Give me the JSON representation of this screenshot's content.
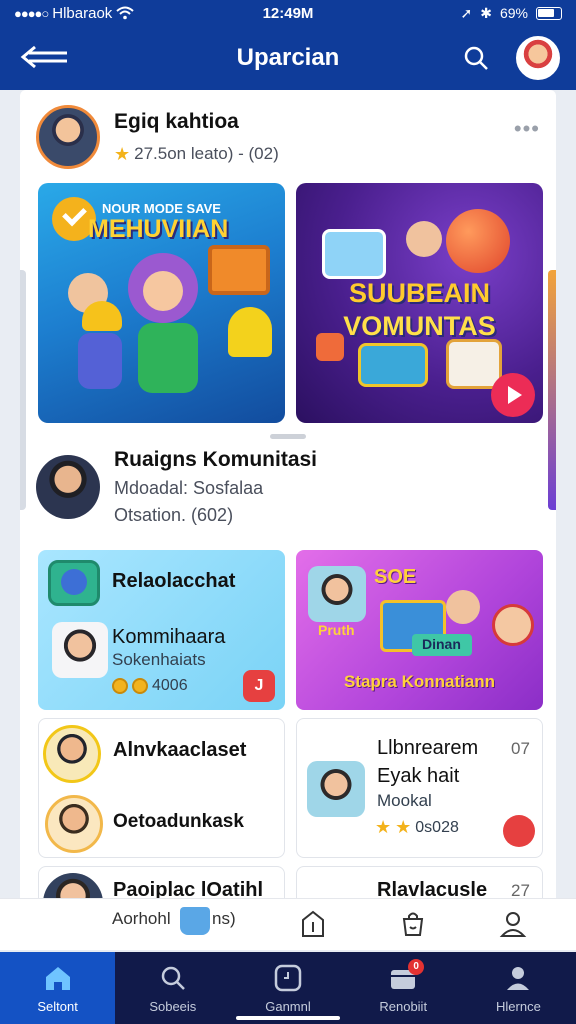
{
  "status_bar": {
    "carrier": "Hlbaraok",
    "time": "12:49M",
    "battery": "69%"
  },
  "header": {
    "title": "Uparcian",
    "back_icon": "arrow-left-icon",
    "search_icon": "search-icon"
  },
  "post1": {
    "name": "Egiq kahtioa",
    "meta": "27.5on leato) - (02)",
    "image1": {
      "top_text": "NOUR MODE SAVE",
      "title": "MEHUVIIAN"
    },
    "image2": {
      "line1": "SUUBEAIN",
      "line2": "VOMUNTAS"
    }
  },
  "post2": {
    "name": "Ruaigns Komunitasi",
    "subtitle": "Mdoadal: Sosfalaa",
    "meta": "Otsation. (602)"
  },
  "tiles": {
    "a": {
      "title": "Relaolacchat",
      "name": "Kommihaara",
      "sub": "Sokenhaiats",
      "count": "4006",
      "badge": "J"
    },
    "b": {
      "top": "SOE",
      "left": "Pruth",
      "label": "Dinan",
      "caption": "Stapra Konnatiann"
    },
    "c": {
      "title": "Alnvkaaclaset",
      "sub": "Oetoadunkask"
    },
    "d": {
      "line1": "Llbnrearem",
      "line2": "Eyak hait",
      "line3": "Mookal",
      "count": "0s028",
      "num": "07"
    },
    "e": {
      "title": "Paoiplac lOatihl"
    },
    "f": {
      "title": "Rlavlacusle",
      "num": "27"
    }
  },
  "toolbar": {
    "label": "Aorhohl",
    "suffix": "ns)"
  },
  "tabs": [
    {
      "label": "Seltont",
      "icon": "home-icon"
    },
    {
      "label": "Sobeeis",
      "icon": "search-icon"
    },
    {
      "label": "Ganmnl",
      "icon": "clock-icon"
    },
    {
      "label": "Renobiit",
      "icon": "inbox-icon",
      "badge": "0"
    },
    {
      "label": "Hlernce",
      "icon": "profile-icon"
    }
  ]
}
